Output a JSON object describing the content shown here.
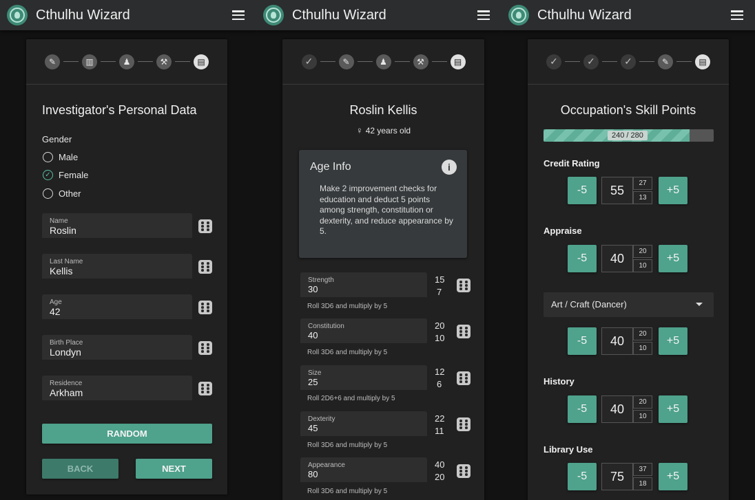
{
  "app": {
    "title": "Cthulhu Wizard"
  },
  "colors": {
    "accent": "#4fa28c",
    "appbar": "#2b2d2e",
    "card": "#212121"
  },
  "screen1": {
    "steps": [
      "pencil-icon",
      "barbell-icon",
      "person-icon",
      "hammer-icon",
      "book-icon"
    ],
    "heading": "Investigator's Personal Data",
    "gender_label": "Gender",
    "gender_options": [
      "Male",
      "Female",
      "Other"
    ],
    "gender_selected": "Female",
    "fields": [
      {
        "label": "Name",
        "value": "Roslin"
      },
      {
        "label": "Last Name",
        "value": "Kellis"
      },
      {
        "label": "Age",
        "value": "42"
      },
      {
        "label": "Birth Place",
        "value": "Londyn"
      },
      {
        "label": "Residence",
        "value": "Arkham"
      }
    ],
    "random_label": "RANDOM",
    "back_label": "BACK",
    "next_label": "NEXT"
  },
  "screen2": {
    "steps": [
      "check-icon",
      "pencil-icon",
      "person-icon",
      "hammer-icon",
      "book-icon"
    ],
    "name": "Roslin Kellis",
    "age_text": "42 years old",
    "info_title": "Age Info",
    "info_text": "Make 2 improvement checks for education and deduct 5 points among strength, constitution or dexterity, and reduce appearance by 5.",
    "attributes": [
      {
        "label": "Strength",
        "value": "30",
        "half": "15",
        "fifth": "7",
        "hint": "Roll 3D6 and multiply by 5"
      },
      {
        "label": "Constitution",
        "value": "40",
        "half": "20",
        "fifth": "10",
        "hint": "Roll 3D6 and multiply by 5"
      },
      {
        "label": "Size",
        "value": "25",
        "half": "12",
        "fifth": "6",
        "hint": "Roll 2D6+6 and multiply by 5"
      },
      {
        "label": "Dexterity",
        "value": "45",
        "half": "22",
        "fifth": "11",
        "hint": "Roll 3D6 and multiply by 5"
      },
      {
        "label": "Appearance",
        "value": "80",
        "half": "40",
        "fifth": "20",
        "hint": "Roll 3D6 and multiply by 5"
      }
    ]
  },
  "screen3": {
    "steps": [
      "check-icon",
      "check-icon",
      "check-icon",
      "pencil-icon",
      "book-icon"
    ],
    "heading": "Occupation's Skill Points",
    "progress_text": "240 / 280",
    "progress_fraction": 0.857,
    "minus_label": "-5",
    "plus_label": "+5",
    "skills": [
      {
        "name": "Credit Rating",
        "value": "55",
        "half": "27",
        "fifth": "13"
      },
      {
        "name": "Appraise",
        "value": "40",
        "half": "20",
        "fifth": "10"
      },
      {
        "name": "Art / Craft (Dancer)",
        "value": "40",
        "half": "20",
        "fifth": "10",
        "select": true
      },
      {
        "name": "History",
        "value": "40",
        "half": "20",
        "fifth": "10"
      },
      {
        "name": "Library Use",
        "value": "75",
        "half": "37",
        "fifth": "18"
      }
    ]
  }
}
